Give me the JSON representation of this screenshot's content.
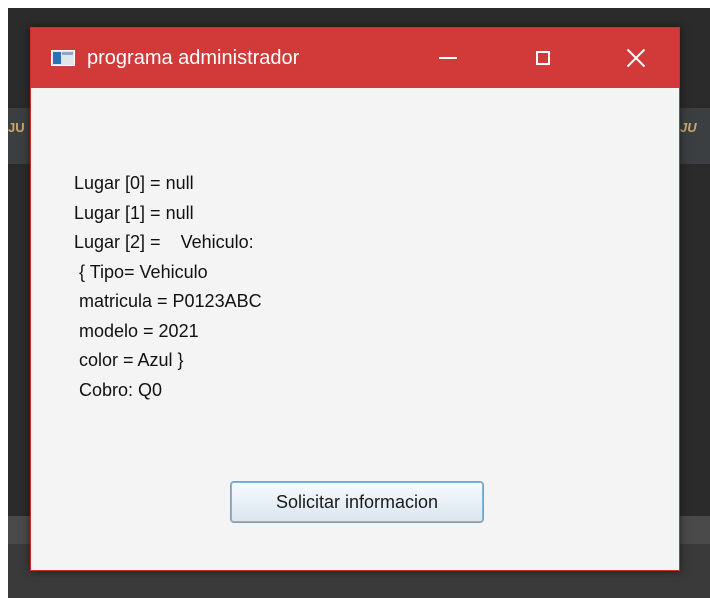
{
  "window": {
    "title": "programa administrador"
  },
  "icons": {
    "app": "java-app-icon",
    "minimize": "minimize-icon",
    "maximize": "maximize-icon",
    "close": "close-icon"
  },
  "info_text": "Lugar [0] = null\nLugar [1] = null\nLugar [2] =    Vehiculo:\n { Tipo= Vehiculo\n matricula = P0123ABC\n modelo = 2021\n color = Azul }\n Cobro: Q0",
  "button": {
    "label": "Solicitar informacion"
  },
  "colors": {
    "titlebar": "#d23a3a",
    "window_bg": "#f4f4f4",
    "background_app": "#2b2b2b"
  }
}
